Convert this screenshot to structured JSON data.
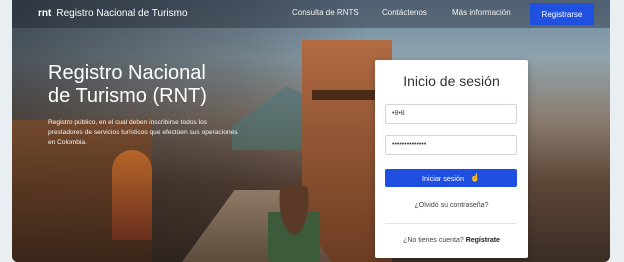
{
  "navbar": {
    "brand_logo": "rnt",
    "brand_text": "Registro Nacional de Turismo",
    "links": [
      "Consulta de RNTS",
      "Contáctenos",
      "Más información"
    ],
    "register_label": "Registrarse"
  },
  "hero": {
    "title_line1": "Registro Nacional",
    "title_line2": "de Turismo (RNT)",
    "description": "Registro público, en el cual deben inscribirse todos los prestadores de servicios turísticos que efectúen sus operaciones en Colombia."
  },
  "login": {
    "title": "Inicio de sesión",
    "username_value": "•8•8",
    "password_value": "••••••••••••••",
    "submit_label": "Iniciar sesión",
    "forgot_label": "¿Olvidó su contraseña?",
    "signup_prompt": "¿No tienes cuenta?",
    "signup_link": "Regístrate"
  },
  "colors": {
    "primary": "#1f50e0",
    "card_bg": "#ffffff"
  },
  "icons": {
    "cursor": "pointer-hand-icon"
  }
}
